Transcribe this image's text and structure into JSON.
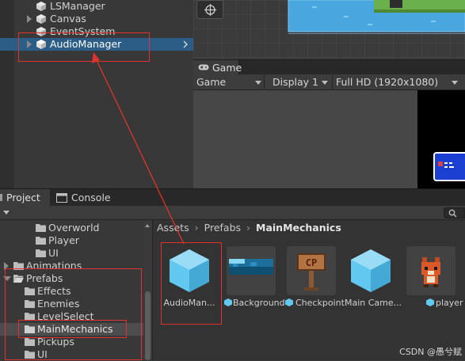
{
  "hierarchy": {
    "items": [
      {
        "label": "LSManager",
        "expandable": false
      },
      {
        "label": "Canvas",
        "expandable": true
      },
      {
        "label": "EventSystem",
        "expandable": false
      },
      {
        "label": "AudioManager",
        "expandable": true,
        "selected": true
      }
    ]
  },
  "game": {
    "tab_label": "Game",
    "toolbar": {
      "mode": "Game",
      "display": "Display 1",
      "resolution": "Full HD (1920x1080)"
    }
  },
  "bottom_panel": {
    "tabs": [
      {
        "label": "Project",
        "active": true
      },
      {
        "label": "Console",
        "active": false
      }
    ]
  },
  "project_tree": [
    {
      "label": "Overworld",
      "level": 3
    },
    {
      "label": "Player",
      "level": 3
    },
    {
      "label": "UI",
      "level": 3
    },
    {
      "label": "Animations",
      "level": 1,
      "expanded": false
    },
    {
      "label": "Prefabs",
      "level": 1,
      "expanded": true
    },
    {
      "label": "Effects",
      "level": 2
    },
    {
      "label": "Enemies",
      "level": 2
    },
    {
      "label": "LevelSelect",
      "level": 2
    },
    {
      "label": "MainMechanics",
      "level": 2,
      "selected": true
    },
    {
      "label": "Pickups",
      "level": 2
    },
    {
      "label": "UI",
      "level": 2
    }
  ],
  "breadcrumb": {
    "parts": [
      "Assets",
      "Prefabs",
      "MainMechanics"
    ]
  },
  "assets": [
    {
      "label": "AudioMan...",
      "icon": "prefab-cube-icon",
      "has_badge": false
    },
    {
      "label": "Background",
      "icon": "background-thumbnail",
      "has_badge": true
    },
    {
      "label": "Checkpoint",
      "icon": "checkpoint-sign-thumbnail",
      "has_badge": true
    },
    {
      "label": "Main Came...",
      "icon": "prefab-cube-icon",
      "has_badge": false
    },
    {
      "label": "player",
      "icon": "fox-sprite-thumbnail",
      "has_badge": true
    }
  ],
  "watermark": "CSDN @愚兮赋",
  "colors": {
    "selection": "#2c5d87",
    "annotation_red": "#e0332f",
    "prefab_cube": "#62c8f0"
  }
}
